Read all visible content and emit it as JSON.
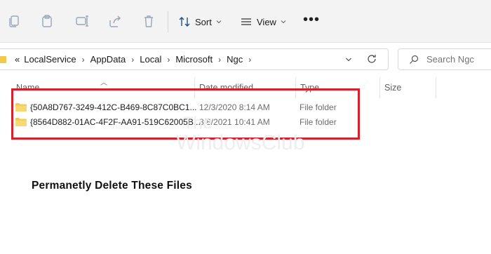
{
  "toolbar": {
    "sort_label": "Sort",
    "view_label": "View",
    "more_label": "•••"
  },
  "address": {
    "overflow": "«",
    "crumbs": [
      "LocalService",
      "AppData",
      "Local",
      "Microsoft",
      "Ngc"
    ]
  },
  "search": {
    "placeholder": "Search Ngc"
  },
  "columns": {
    "name": "Name",
    "date": "Date modified",
    "type": "Type",
    "size": "Size"
  },
  "files": [
    {
      "name": "{50A8D767-3249-412C-B469-8C87C0BC1...",
      "date": "12/3/2020 8:14 AM",
      "type": "File folder"
    },
    {
      "name": "{8564D882-01AC-4F2F-AA91-519C62005B...",
      "date": "8/8/2021 10:41 AM",
      "type": "File folder"
    }
  ],
  "watermark": {
    "line1": "The",
    "line2": "WindowsClub"
  },
  "caption": "Permanetly Delete These Files",
  "colors": {
    "highlight": "#d9202a",
    "folder": "#f2c94c",
    "toolbar_bg": "#f3f3f3"
  },
  "icons": [
    "copy-icon",
    "paste-icon",
    "rename-icon",
    "share-icon",
    "delete-icon",
    "sort-icon",
    "view-icon",
    "refresh-icon",
    "search-icon",
    "folder-icon"
  ]
}
